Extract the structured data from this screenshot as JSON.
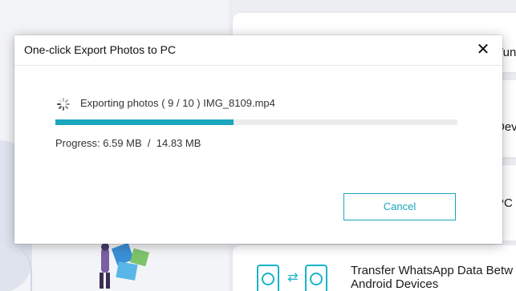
{
  "background": {
    "cards": [
      {
        "label": "Tun"
      },
      {
        "label": "Devi"
      },
      {
        "label": "PC"
      },
      {
        "label_line1": "Transfer WhatsApp Data Betw",
        "label_line2": "Android Devices"
      }
    ],
    "accent_color": "#19b4c9"
  },
  "dialog": {
    "title": "One-click Export Photos to PC",
    "status": {
      "prefix": "Exporting photos",
      "counter": "( 9 / 10 )",
      "filename": "IMG_8109.mp4"
    },
    "progress": {
      "label": "Progress:",
      "done": "6.59 MB",
      "separator": "/",
      "total": "14.83 MB",
      "fraction": 0.444
    },
    "cancel_label": "Cancel",
    "icons": {
      "close": "close-icon",
      "spinner": "loading-spinner-icon"
    },
    "accent_color": "#19a6be"
  }
}
